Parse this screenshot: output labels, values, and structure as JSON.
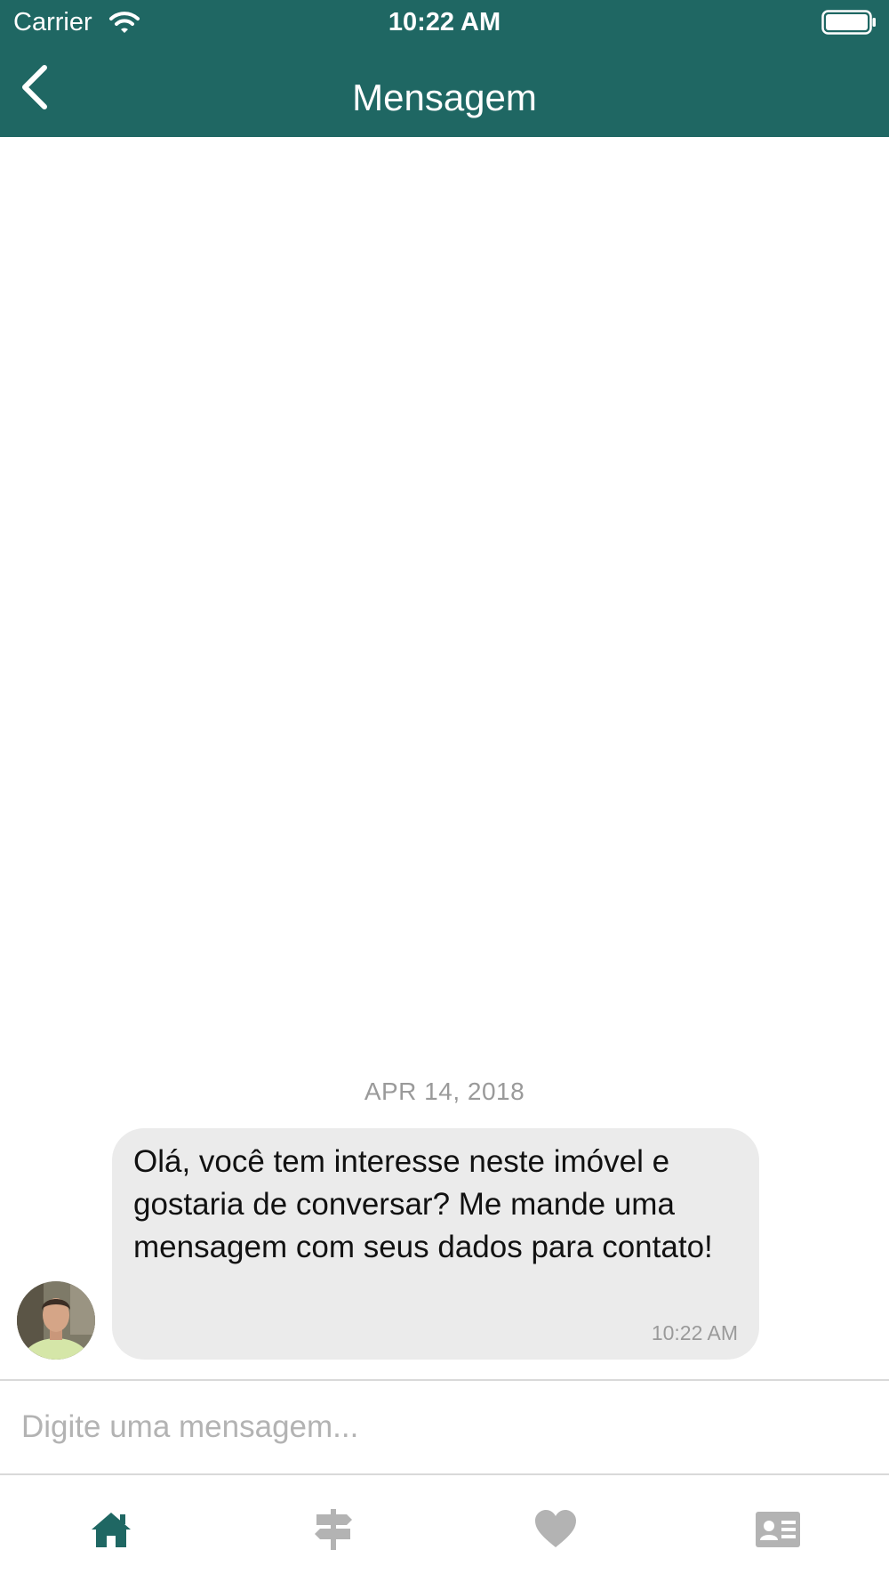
{
  "status_bar": {
    "carrier": "Carrier",
    "time": "10:22 AM",
    "icons": [
      "wifi-icon",
      "battery-icon"
    ]
  },
  "nav": {
    "title": "Mensagem",
    "back_icon": "chevron-left-icon"
  },
  "conversation": {
    "date": "APR 14, 2018",
    "messages": [
      {
        "text": "Olá, você tem interesse neste imóvel e gostaria de conversar? Me mande uma mensagem com seus dados para contato!",
        "time": "10:22 AM",
        "avatar": "user-avatar"
      }
    ]
  },
  "composer": {
    "placeholder": "Digite uma mensagem...",
    "value": ""
  },
  "tabs": [
    {
      "icon": "home-icon",
      "active": true
    },
    {
      "icon": "signpost-icon",
      "active": false
    },
    {
      "icon": "heart-icon",
      "active": false
    },
    {
      "icon": "contact-card-icon",
      "active": false
    }
  ],
  "colors": {
    "header": "#1f6763",
    "tab_active": "#1f6763",
    "tab_inactive": "#b3b3b3",
    "bubble": "#ebebeb"
  }
}
